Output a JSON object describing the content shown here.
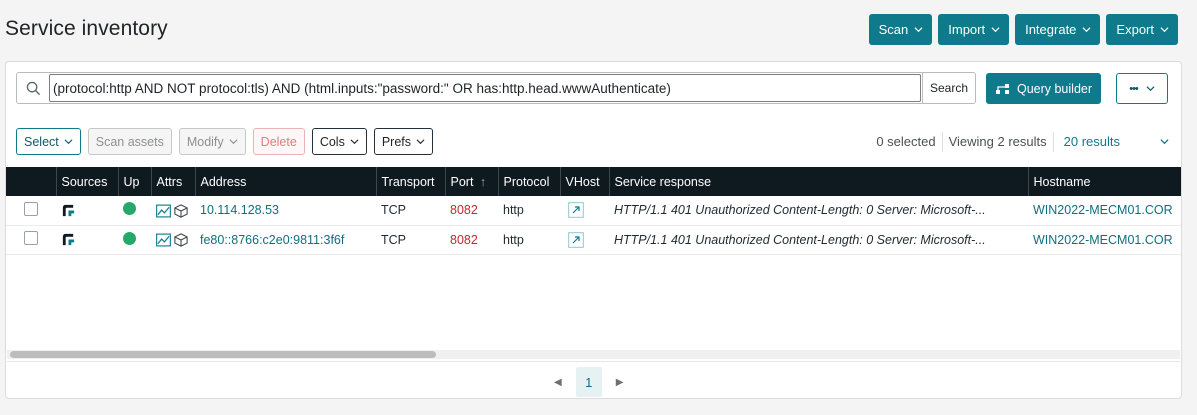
{
  "page": {
    "title": "Service inventory"
  },
  "top_actions": [
    {
      "label": "Scan"
    },
    {
      "label": "Import"
    },
    {
      "label": "Integrate"
    },
    {
      "label": "Export"
    }
  ],
  "search": {
    "query": "(protocol:http AND NOT protocol:tls) AND (html.inputs:\"password:\" OR has:http.head.wwwAuthenticate)",
    "button_label": "Search",
    "query_builder_label": "Query builder",
    "more_label": "•••"
  },
  "toolbar": {
    "select_label": "Select",
    "scan_assets_label": "Scan assets",
    "modify_label": "Modify",
    "delete_label": "Delete",
    "cols_label": "Cols",
    "prefs_label": "Prefs"
  },
  "status": {
    "selected_text": "0 selected",
    "viewing_text": "Viewing 2 results",
    "page_size_text": "20 results"
  },
  "table": {
    "columns": [
      "Sources",
      "Up",
      "Attrs",
      "Address",
      "Transport",
      "Port",
      "Protocol",
      "VHost",
      "Service response",
      "Hostname"
    ],
    "sort_indicator": "↑",
    "rows": [
      {
        "address": "10.114.128.53",
        "transport": "TCP",
        "port": "8082",
        "protocol": "http",
        "service_response": "HTTP/1.1 401 Unauthorized Content-Length: 0 Server: Microsoft-...",
        "hostname": "WIN2022-MECM01.COR"
      },
      {
        "address": "fe80::8766:c2e0:9811:3f6f",
        "transport": "TCP",
        "port": "8082",
        "protocol": "http",
        "service_response": "HTTP/1.1 401 Unauthorized Content-Length: 0 Server: Microsoft-...",
        "hostname": "WIN2022-MECM01.COR"
      }
    ]
  },
  "pagination": {
    "prev": "◀",
    "current": "1",
    "next": "▶"
  },
  "colors": {
    "accent": "#0e7a8b",
    "header_bg": "#0f1920",
    "port": "#c2282f",
    "up": "#27a86b"
  }
}
